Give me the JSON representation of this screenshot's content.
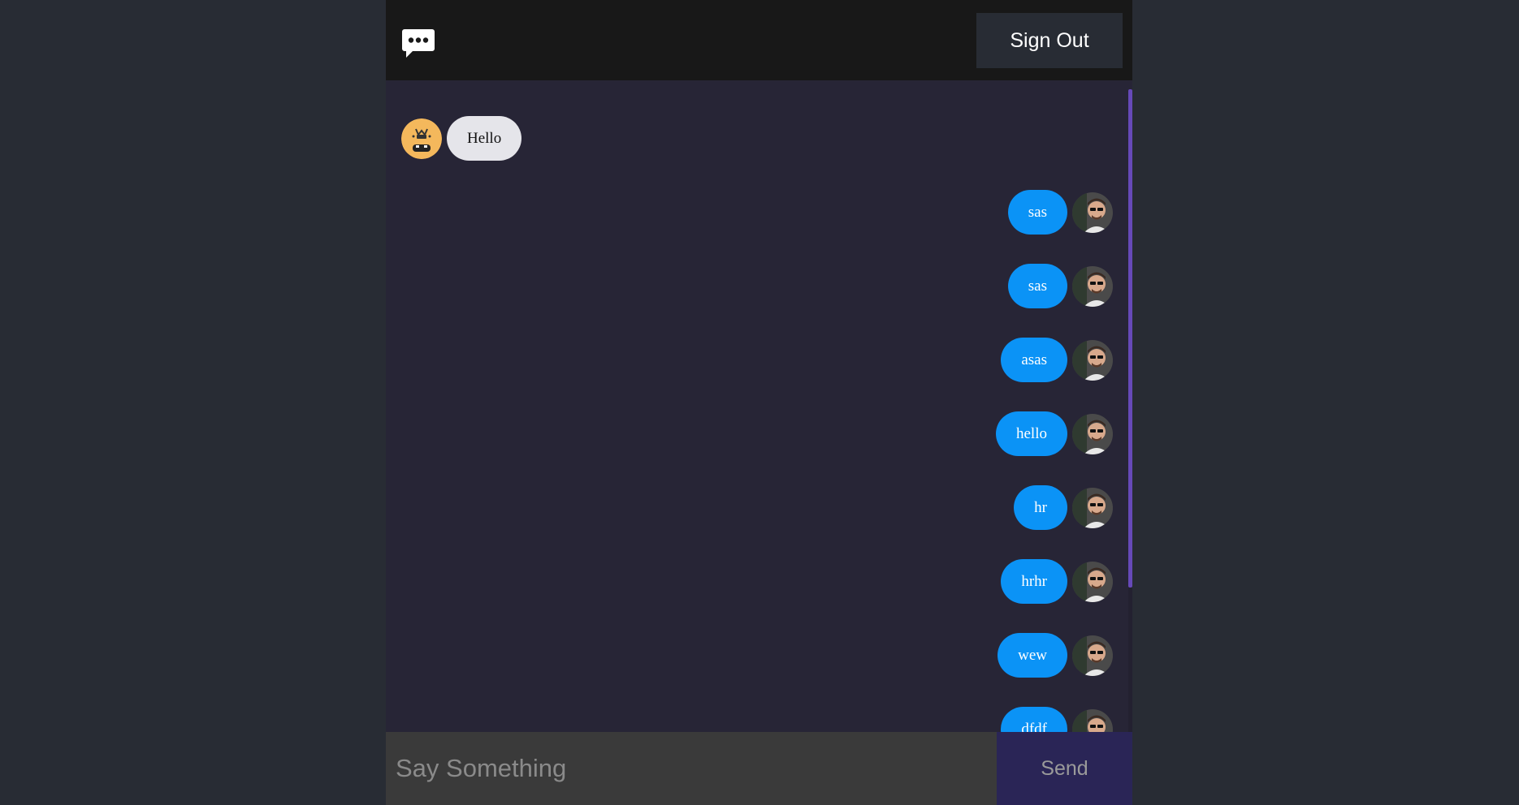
{
  "header": {
    "logo_icon": "chat-bubble-icon",
    "sign_out_label": "Sign Out"
  },
  "messages": [
    {
      "direction": "received",
      "text": "Hello",
      "avatar": "emoji-avatar"
    },
    {
      "direction": "sent",
      "text": "sas",
      "avatar": "user-photo-avatar"
    },
    {
      "direction": "sent",
      "text": "sas",
      "avatar": "user-photo-avatar"
    },
    {
      "direction": "sent",
      "text": "asas",
      "avatar": "user-photo-avatar"
    },
    {
      "direction": "sent",
      "text": "hello",
      "avatar": "user-photo-avatar"
    },
    {
      "direction": "sent",
      "text": "hr",
      "avatar": "user-photo-avatar"
    },
    {
      "direction": "sent",
      "text": "hrhr",
      "avatar": "user-photo-avatar"
    },
    {
      "direction": "sent",
      "text": "wew",
      "avatar": "user-photo-avatar"
    },
    {
      "direction": "sent",
      "text": "dfdf",
      "avatar": "user-photo-avatar"
    }
  ],
  "composer": {
    "placeholder": "Say Something",
    "value": "",
    "send_label": "Send"
  },
  "colors": {
    "page_bg": "#282c34",
    "app_bg": "#272536",
    "header_bg": "#181818",
    "sent_bubble": "#0b93f6",
    "received_bubble": "#e5e5ea",
    "scrollbar": "#6649b8",
    "send_bg": "#2a2556"
  }
}
